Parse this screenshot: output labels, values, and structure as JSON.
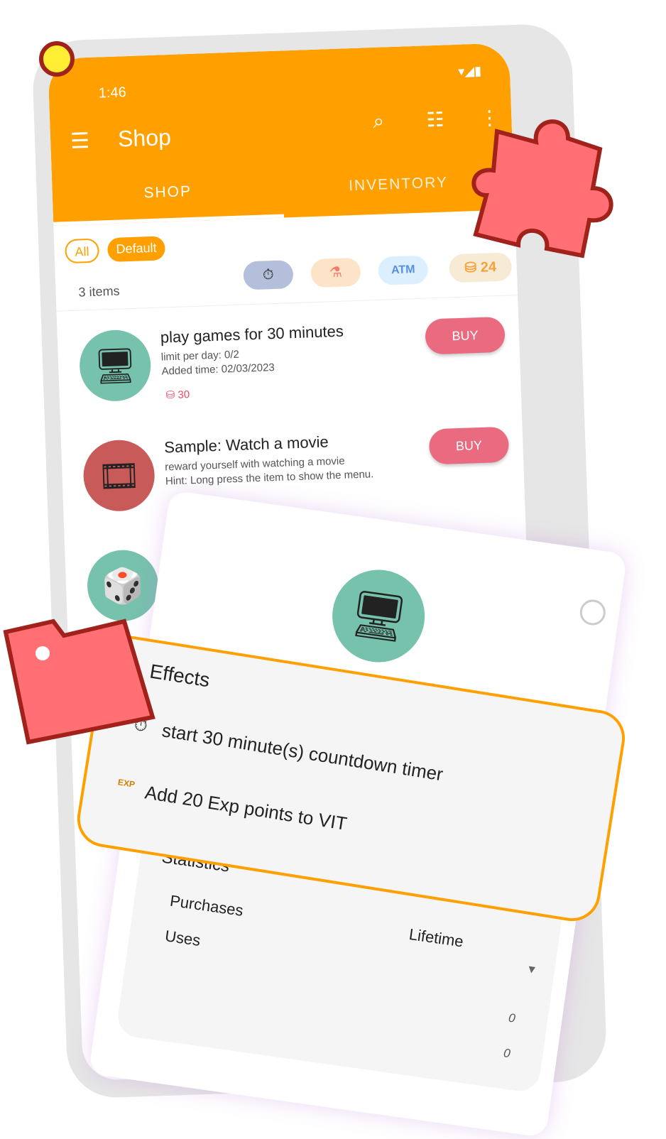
{
  "status": {
    "time": "1:46",
    "icons": [
      "wifi-icon",
      "signal-icon",
      "battery-icon"
    ]
  },
  "appbar": {
    "title": "Shop",
    "actions": [
      "search-icon",
      "list-icon",
      "more-vert-icon"
    ],
    "tabs": [
      {
        "label": "SHOP",
        "active": true
      },
      {
        "label": "INVENTORY",
        "active": false
      }
    ]
  },
  "filters": {
    "chips": [
      "All",
      "Default"
    ]
  },
  "balances": {
    "coins": "24",
    "pills": [
      "timer-icon",
      "flask-icon",
      "ATM"
    ]
  },
  "list": {
    "count": "3 items",
    "items": [
      {
        "name": "play games for 30 minutes",
        "line1": "limit per day: 0/2",
        "line2": "Added time: 02/03/2023",
        "price": "30",
        "buy": "BUY",
        "icon": "monitor-icon"
      },
      {
        "name": "Sample: Watch a movie",
        "line1": "reward yourself with watching a movie",
        "line2": "Hint: Long press the item to show the menu.",
        "buy": "BUY",
        "icon": "film-icon"
      },
      {
        "icon": "dice-icon"
      }
    ]
  },
  "detail": {
    "title": "play games for 30 minutes",
    "effects_heading": "Effects",
    "effects": [
      "start 30 minute(s) countdown timer",
      "Add 20 Exp points to VIT"
    ],
    "stats_heading": "Statistics",
    "period": "Lifetime",
    "rows": [
      {
        "label": "Purchases",
        "value": "0"
      },
      {
        "label": "Uses",
        "value": "0"
      }
    ]
  },
  "colors": {
    "accent": "#ffa000",
    "buy": "#ea6a80",
    "teal": "#76c2ad",
    "puzzle": "#ff6f73"
  }
}
